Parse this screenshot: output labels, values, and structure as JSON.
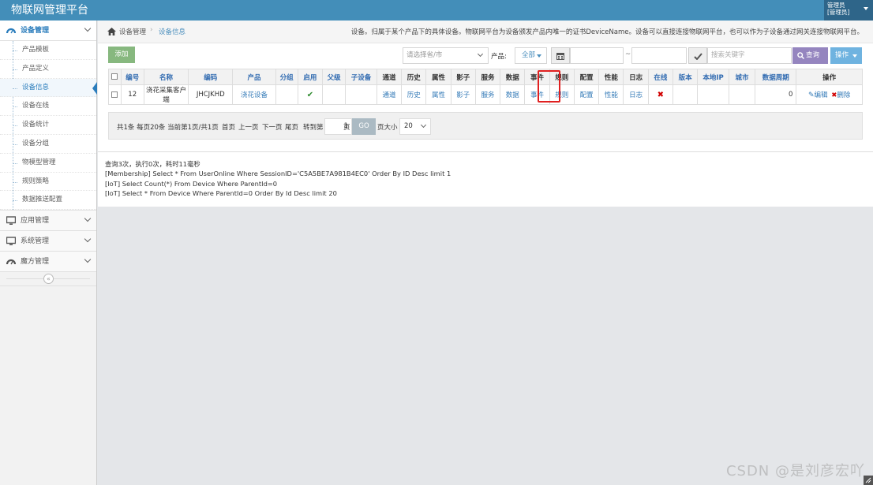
{
  "app": {
    "title": "物联网管理平台"
  },
  "user": {
    "line1": "管理员",
    "line2": "[管理员]"
  },
  "sidebar": {
    "device_mgmt": "设备管理",
    "items": [
      "产品模板",
      "产品定义",
      "设备信息",
      "设备在线",
      "设备统计",
      "设备分组",
      "物模型管理",
      "规则策略",
      "数据推送配置"
    ],
    "active_item": "设备信息",
    "app_mgmt": "应用管理",
    "sys_mgmt": "系统管理",
    "cube_mgmt": "魔方管理",
    "collapse_glyph": "«"
  },
  "breadcrumb": {
    "root": "设备管理",
    "sep": "›",
    "current": "设备信息"
  },
  "description": "设备。归属于某个产品下的具体设备。物联网平台为设备颁发产品内唯一的证书DeviceName。设备可以直接连接物联网平台，也可以作为子设备通过网关连接物联网平台。",
  "toolbar": {
    "add_label": "添加",
    "province_placeholder": "请选择省/市",
    "product_label": "产品:",
    "product_value": "全部",
    "range_sep": "~",
    "search_placeholder": "搜索关键字",
    "query_label": "查询",
    "action_label": "操作"
  },
  "table": {
    "headers": [
      "编号",
      "名称",
      "编码",
      "产品",
      "分组",
      "启用",
      "父级",
      "子设备",
      "通道",
      "历史",
      "属性",
      "影子",
      "服务",
      "数据",
      "事件",
      "规则",
      "配置",
      "性能",
      "日志",
      "在线",
      "版本",
      "本地IP",
      "城市",
      "数据周期",
      "操作"
    ],
    "row": {
      "id": "12",
      "name": "浇花采集客户端",
      "code": "JHCJKHD",
      "product": "浇花设备",
      "enabled_glyph": "✔",
      "channel": "通道",
      "history": "历史",
      "property": "属性",
      "shadow": "影子",
      "service": "服务",
      "data": "数据",
      "event": "事件",
      "rule": "规则",
      "config": "配置",
      "perf": "性能",
      "log": "日志",
      "online_glyph": "✖",
      "period": "0",
      "edit": "编辑",
      "delete": "删除"
    }
  },
  "pager": {
    "summary": "共1条 每页20条 当前第1页/共1页",
    "first": "首页",
    "prev": "上一页",
    "next": "下一页",
    "last": "尾页",
    "goto_label": "转到第",
    "page_value": "1",
    "page_unit": "页",
    "go_label": "GO",
    "size_label": "页大小",
    "size_value": "20"
  },
  "log": {
    "line1": "查询3次，执行0次，耗时11毫秒",
    "line2": "[Membership] Select * From UserOnline Where SessionID='C5A5BE7A981B4EC0' Order By ID Desc limit 1",
    "line3": "[IoT] Select Count(*) From Device Where ParentId=0",
    "line4": "[IoT] Select * From Device Where ParentId=0 Order By Id Desc limit 20"
  },
  "watermark": "CSDN @是刘彦宏吖",
  "colors": {
    "navbar": "#438eb9",
    "accent": "#2b7dbc",
    "add_button": "#87b87f",
    "highlight": "#e02020"
  }
}
